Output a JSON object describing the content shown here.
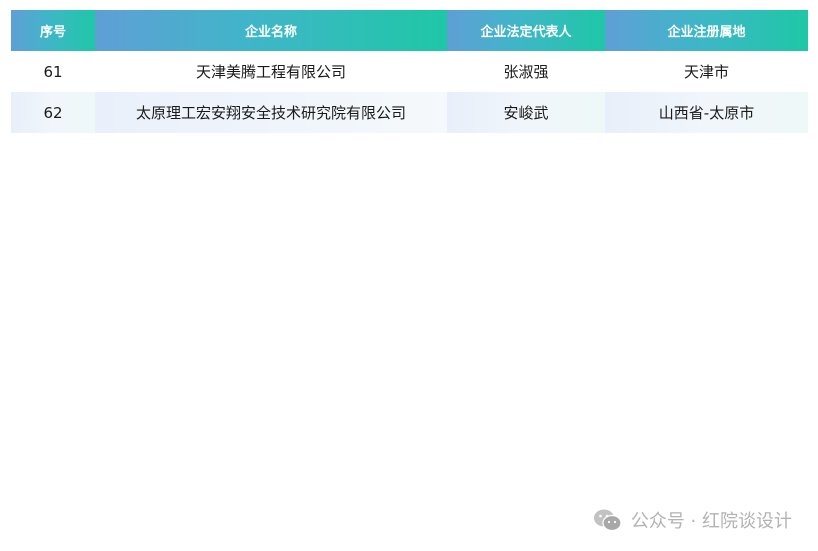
{
  "table": {
    "headers": [
      "序号",
      "企业名称",
      "企业法定代表人",
      "企业注册属地"
    ],
    "rows": [
      [
        "61",
        "天津美腾工程有限公司",
        "张淑强",
        "天津市"
      ],
      [
        "62",
        "太原理工宏安翔安全技术研究院有限公司",
        "安峻武",
        "山西省-太原市"
      ]
    ]
  },
  "watermark": {
    "text": "公众号 · 红院谈设计",
    "icon": "wechat-icon"
  },
  "colors": {
    "header_start": "#5f9fd6",
    "header_end": "#1fc7a6",
    "alt_row": "#eef3fa"
  }
}
